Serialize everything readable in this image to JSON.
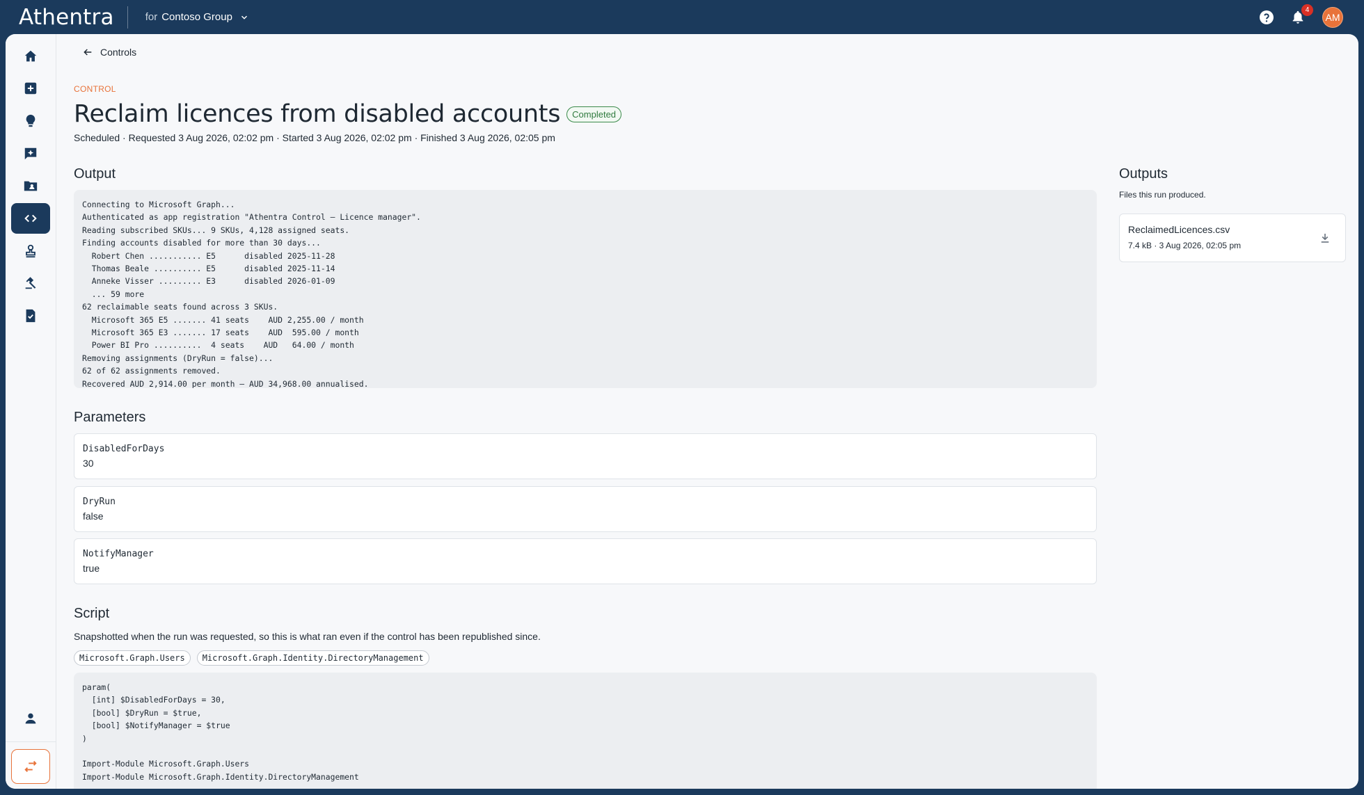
{
  "app": {
    "brand": "Athentra",
    "tenant_prefix": "for",
    "tenant_name": "Contoso Group",
    "notifications_count": "4",
    "avatar_initials": "AM",
    "accent": "#e8733a",
    "nav_bg": "#1b3a5c"
  },
  "sidebar": {
    "items": [
      {
        "icon": "home-icon"
      },
      {
        "icon": "add-box-icon"
      },
      {
        "icon": "lightbulb-icon"
      },
      {
        "icon": "sparkle-chat-icon"
      },
      {
        "icon": "folder-user-icon"
      },
      {
        "icon": "code-icon",
        "active": true
      },
      {
        "icon": "stamp-icon"
      },
      {
        "icon": "gavel-icon"
      },
      {
        "icon": "task-check-icon"
      }
    ],
    "bottom": [
      {
        "icon": "person-icon"
      },
      {
        "icon": "swap-icon"
      }
    ]
  },
  "page": {
    "back_label": "Controls",
    "eyebrow": "CONTROL",
    "title": "Reclaim licences from disabled accounts",
    "status": "Completed",
    "meta": "Scheduled · Requested 3 Aug 2026, 02:02 pm · Started 3 Aug 2026, 02:02 pm · Finished 3 Aug 2026, 02:05 pm"
  },
  "output": {
    "title": "Output",
    "log": "Connecting to Microsoft Graph...\nAuthenticated as app registration \"Athentra Control — Licence manager\".\nReading subscribed SKUs... 9 SKUs, 4,128 assigned seats.\nFinding accounts disabled for more than 30 days...\n  Robert Chen ........... E5      disabled 2025-11-28\n  Thomas Beale .......... E5      disabled 2025-11-14\n  Anneke Visser ......... E3      disabled 2026-01-09\n  ... 59 more\n62 reclaimable seats found across 3 SKUs.\n  Microsoft 365 E5 ....... 41 seats    AUD 2,255.00 / month\n  Microsoft 365 E3 ....... 17 seats    AUD  595.00 / month\n  Power BI Pro ..........  4 seats    AUD   64.00 / month\nRemoving assignments (DryRun = false)...\n62 of 62 assignments removed.\nRecovered AUD 2,914.00 per month — AUD 34,968.00 annualised."
  },
  "parameters": {
    "title": "Parameters",
    "items": [
      {
        "name": "DisabledForDays",
        "value": "30"
      },
      {
        "name": "DryRun",
        "value": "false"
      },
      {
        "name": "NotifyManager",
        "value": "true"
      }
    ]
  },
  "script": {
    "title": "Script",
    "subtitle": "Snapshotted when the run was requested, so this is what ran even if the control has been republished since.",
    "modules": [
      "Microsoft.Graph.Users",
      "Microsoft.Graph.Identity.DirectoryManagement"
    ],
    "code": "param(\n  [int] $DisabledForDays = 30,\n  [bool] $DryRun = $true,\n  [bool] $NotifyManager = $true\n)\n\nImport-Module Microsoft.Graph.Users\nImport-Module Microsoft.Graph.Identity.DirectoryManagement"
  },
  "outputs": {
    "title": "Outputs",
    "subtitle": "Files this run produced.",
    "files": [
      {
        "name": "ReclaimedLicences.csv",
        "meta": "7.4 kB · 3 Aug 2026, 02:05 pm"
      }
    ]
  }
}
